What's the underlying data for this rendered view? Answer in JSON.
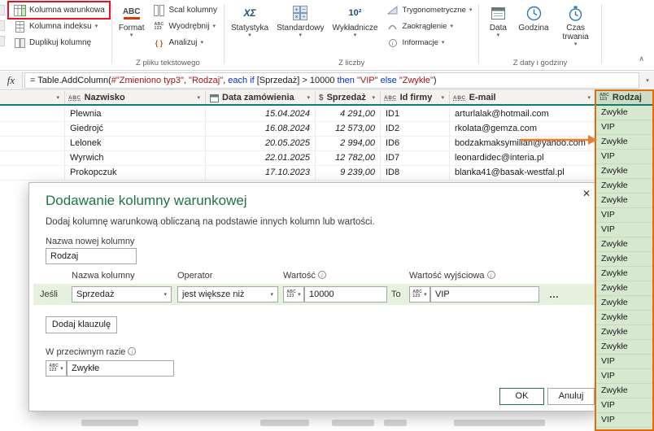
{
  "ribbon": {
    "conditional_column": "Kolumna warunkowa",
    "index_column": "Kolumna indeksu",
    "duplicate_column": "Duplikuj kolumnę",
    "format": "Format",
    "merge_columns": "Scal kolumny",
    "extract": "Wyodrębnij",
    "parse": "Analizuj",
    "group_text_file": "Z pliku tekstowego",
    "statistics": "Statystyka",
    "standard": "Standardowy",
    "scientific": "Wykładnicze",
    "trigonometry": "Trygonometryczne",
    "rounding": "Zaokrąglenie",
    "information": "Informacje",
    "group_number": "Z liczby",
    "date": "Data",
    "time": "Godzina",
    "duration": "Czas trwania",
    "group_datetime": "Z daty i godziny"
  },
  "icons": {
    "dropdown": "▾",
    "filter": "▾",
    "collapse": "∧",
    "close": "✕",
    "more": "…",
    "info": "i",
    "fx": "fx",
    "statistics_glyph": "ΧΣ",
    "scientific_glyph": "10²",
    "format_glyph": "ABC",
    "parse_glyph": "{ }",
    "abc": "ABC",
    "num123": "123",
    "dollar": "$"
  },
  "formula_bar": {
    "tokens": [
      {
        "text": "= Table.AddColumn(",
        "color": "plain"
      },
      {
        "text": "#\"Zmieniono typ3\"",
        "color": "string"
      },
      {
        "text": ", ",
        "color": "plain"
      },
      {
        "text": "\"Rodzaj\"",
        "color": "string"
      },
      {
        "text": ", ",
        "color": "plain"
      },
      {
        "text": "each ",
        "color": "keyword"
      },
      {
        "text": "if ",
        "color": "keyword"
      },
      {
        "text": "[Sprzedaż] > ",
        "color": "plain"
      },
      {
        "text": "10000 ",
        "color": "plain"
      },
      {
        "text": "then ",
        "color": "keyword"
      },
      {
        "text": "\"VIP\" ",
        "color": "string"
      },
      {
        "text": "else ",
        "color": "keyword"
      },
      {
        "text": "\"Zwykłe\"",
        "color": "string"
      },
      {
        "text": ")",
        "color": "plain"
      }
    ]
  },
  "table": {
    "columns": {
      "nazwisko": "Nazwisko",
      "data_zamowienia": "Data zamówienia",
      "sprzedaz": "Sprzedaż",
      "id_firmy": "Id firmy",
      "email": "E-mail",
      "rodzaj": "Rodzaj"
    },
    "rows": [
      {
        "nazwisko": "Plewnia",
        "data_zamowienia": "15.04.2024",
        "sprzedaz": "4 291,00",
        "id_firmy": "ID1",
        "email": "arturlalak@hotmail.com"
      },
      {
        "nazwisko": "Giedrojć",
        "data_zamowienia": "16.08.2024",
        "sprzedaz": "12 573,00",
        "id_firmy": "ID2",
        "email": "rkolata@gemza.com"
      },
      {
        "nazwisko": "Lelonek",
        "data_zamowienia": "20.05.2025",
        "sprzedaz": "2 994,00",
        "id_firmy": "ID6",
        "email": "bodzakmaksymilian@yahoo.com"
      },
      {
        "nazwisko": "Wyrwich",
        "data_zamowienia": "22.01.2025",
        "sprzedaz": "12 782,00",
        "id_firmy": "ID7",
        "email": "leonardidec@interia.pl"
      },
      {
        "nazwisko": "Prokopczuk",
        "data_zamowienia": "17.10.2023",
        "sprzedaz": "9 239,00",
        "id_firmy": "ID8",
        "email": "blanka41@basak-westfal.pl"
      }
    ],
    "rodzaj_values": [
      "Zwykłe",
      "VIP",
      "Zwykłe",
      "VIP",
      "Zwykłe",
      "Zwykłe",
      "Zwykłe",
      "VIP",
      "VIP",
      "Zwykłe",
      "Zwykłe",
      "Zwykłe",
      "Zwykłe",
      "Zwykłe",
      "Zwykłe",
      "Zwykłe",
      "Zwykłe",
      "VIP",
      "VIP",
      "Zwykłe",
      "VIP",
      "VIP"
    ]
  },
  "dialog": {
    "title": "Dodawanie kolumny warunkowej",
    "description": "Dodaj kolumnę warunkową obliczaną na podstawie innych kolumn lub wartości.",
    "new_column_label": "Nazwa nowej kolumny",
    "new_column_value": "Rodzaj",
    "col_header_column": "Nazwa kolumny",
    "col_header_operator": "Operator",
    "col_header_value": "Wartość",
    "col_header_output": "Wartość wyjściowa",
    "if_label": "Jeśli",
    "condition_column": "Sprzedaż",
    "condition_operator": "jest większe niż",
    "condition_value": "10000",
    "to_label": "To",
    "condition_output": "VIP",
    "add_clause_label": "Dodaj klauzulę",
    "else_label": "W przeciwnym razie",
    "else_value": "Zwykłe",
    "ok_label": "OK",
    "cancel_label": "Anuluj"
  },
  "colors": {
    "accent_green": "#217346",
    "header_underline_teal": "#0e7e6b",
    "selected_column_bg": "#d7e8d0",
    "selected_header_bg": "#ccdcc6",
    "condition_row_bg": "#e7f1e0",
    "highlight_red": "#e81123",
    "column_border_orange": "#e26b0a",
    "arrow_orange": "#ed7d31",
    "string_token": "#a31515",
    "keyword_token": "#0033cc"
  }
}
